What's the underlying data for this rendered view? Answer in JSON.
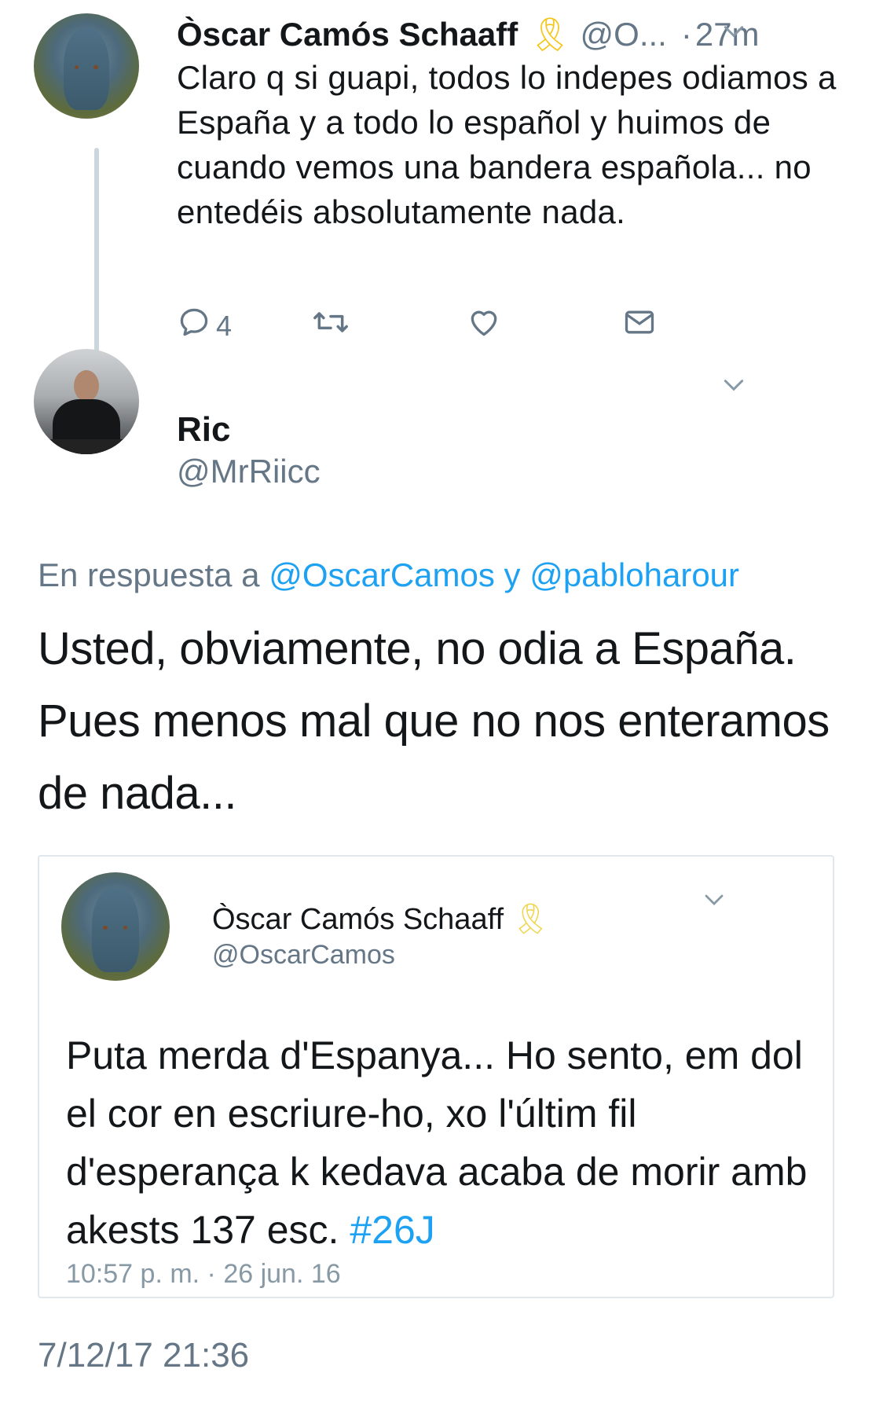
{
  "parent_tweet": {
    "name": "Òscar Camós Schaaff",
    "ribbon": "🎗",
    "handle": "@O...",
    "separator": "·",
    "time": "27m",
    "text": "Claro q si guapi, todos lo indepes odiamos a España y a todo lo español y huimos de cuando vemos una bandera española... no entedéis absolutamente nada.",
    "reply_count": "4",
    "icons": [
      "reply-icon",
      "retweet-icon",
      "like-icon",
      "dm-icon",
      "chevron-down-icon"
    ]
  },
  "main_tweet": {
    "name": "Ric",
    "handle": "@MrRiicc",
    "reply_prefix": "En respuesta a",
    "reply_user_1": "@OscarCamos",
    "reply_conj": "y",
    "reply_user_2": "@pabloharour",
    "text": "Usted, obviamente, no odia a España. Pues menos mal que no nos enteramos de nada...",
    "date": "7/12/17 21:36"
  },
  "quoted_tweet": {
    "name": "Òscar Camós Schaaff",
    "ribbon": "🎗",
    "handle": "@OscarCamos",
    "text": "Puta merda d'Espanya... Ho sento, em dol el cor en escriure-ho, xo l'últim fil d'esperança k kedava acaba de morir amb akests 137 esc.",
    "hashtag": "#26J",
    "timestamp": "10:57 p. m. · 26 jun. 16"
  },
  "colors": {
    "link": "#1da1f2",
    "muted": "#657786",
    "text": "#14171a",
    "ribbon": "#f5c518"
  }
}
